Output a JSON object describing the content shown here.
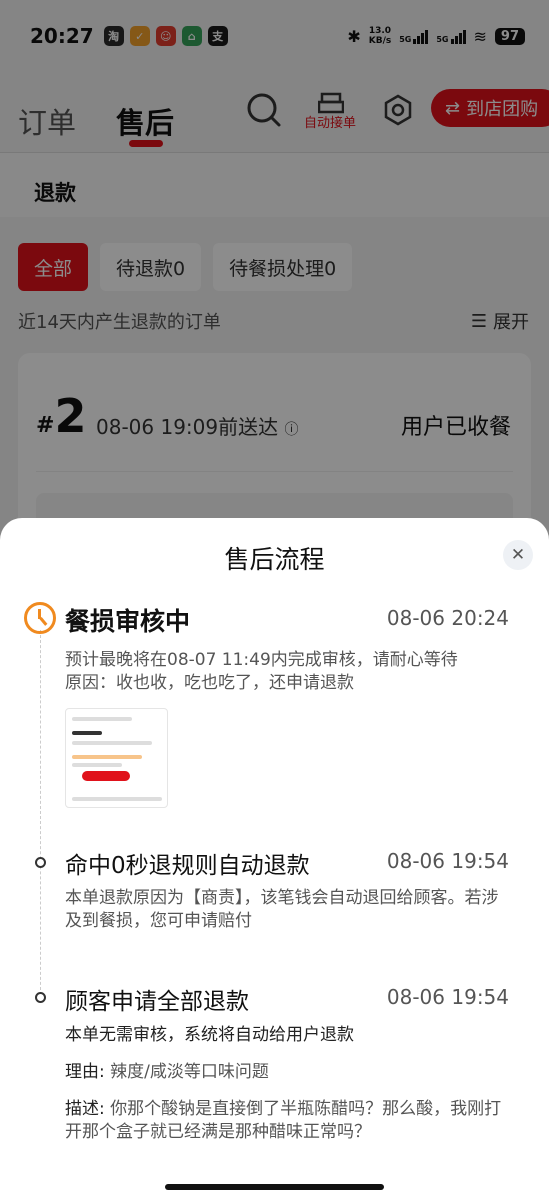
{
  "status_bar": {
    "time": "20:27",
    "speed_value": "13.0",
    "speed_unit": "KB/s",
    "net1": "5G",
    "net2": "5G",
    "battery": "97"
  },
  "status_apps": [
    {
      "glyph": "淘",
      "color": "#2a2a2a"
    },
    {
      "glyph": "✓",
      "color": "#f2a12a"
    },
    {
      "glyph": "☺",
      "color": "#e23c2e"
    },
    {
      "glyph": "⌂",
      "color": "#35a35a"
    },
    {
      "glyph": "支",
      "color": "#1a1a1a"
    }
  ],
  "header": {
    "tab_orders": "订单",
    "tab_aftersale": "售后",
    "auto_accept": "自动接单",
    "store_button": "到店团购"
  },
  "subheader": {
    "title": "退款"
  },
  "filters": [
    {
      "label": "全部"
    },
    {
      "label": "待退款0"
    },
    {
      "label": "待餐损处理0"
    }
  ],
  "info_text": "近14天内产生退款的订单",
  "expand_label": "展开",
  "order_card": {
    "hash": "#",
    "number": "2",
    "delivery_time": "08-06 19:09前送达",
    "status": "用户已收餐"
  },
  "sheet": {
    "title": "售后流程",
    "steps": [
      {
        "title": "餐损审核中",
        "time": "08-06 20:24",
        "line1": "预计最晚将在08-07 11:49内完成审核，请耐心等待",
        "line2": "原因：收也收，吃也吃了，还申请退款"
      },
      {
        "title": "命中0秒退规则自动退款",
        "time": "08-06 19:54",
        "text": "本单退款原因为【商责】，该笔钱会自动退回给顾客。若涉及到餐损，您可申请赔付"
      },
      {
        "title": "顾客申请全部退款",
        "time": "08-06 19:54",
        "text1": "本单无需审核，系统将自动给用户退款",
        "reason_label": "理由:",
        "reason_value": "辣度/咸淡等口味问题",
        "desc_label": "描述:",
        "desc_value": "你那个酸钠是直接倒了半瓶陈醋吗？那么酸，我刚打开那个盒子就已经满是那种醋味正常吗？"
      }
    ]
  },
  "colors": {
    "accent": "#e0121b",
    "pending": "#f08a1f"
  },
  "icons": {
    "search": "search-icon",
    "scanner": "scanner-icon",
    "settings": "settings-icon",
    "swap": "swap-icon",
    "close": "close-icon",
    "clock": "clock-icon",
    "expand": "list-expand-icon"
  }
}
